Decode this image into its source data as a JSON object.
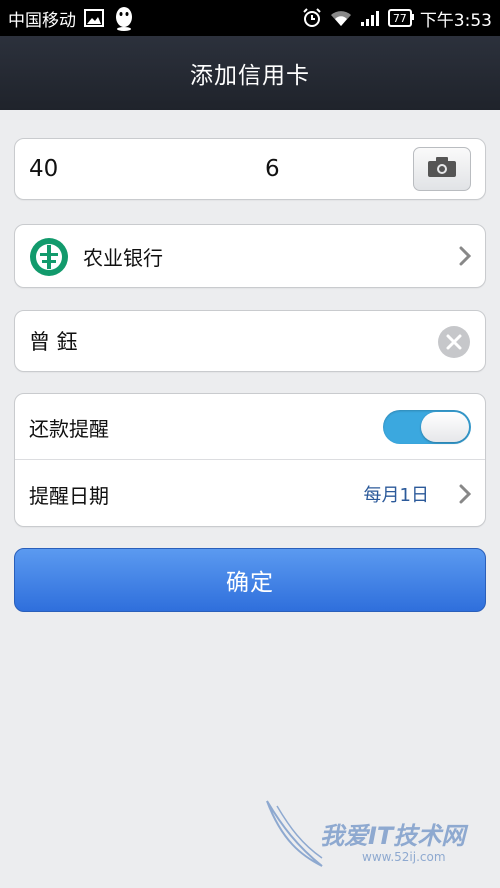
{
  "status_bar": {
    "carrier": "中国移动",
    "battery": "77",
    "time": "下午3:53"
  },
  "header": {
    "title": "添加信用卡"
  },
  "card_number": {
    "value_start": "40",
    "value_end": "6"
  },
  "bank": {
    "name": "农业银行"
  },
  "cardholder": {
    "value": "曾 鈺"
  },
  "settings": {
    "reminder_label": "还款提醒",
    "reminder_on": true,
    "date_label": "提醒日期",
    "date_value": "每月1日"
  },
  "confirm_label": "确定",
  "watermark": {
    "text": "我爱IT技术网",
    "sub": "www.52ij.com"
  },
  "colors": {
    "header_bg": "#262a33",
    "accent_blue": "#3ba8df",
    "button_blue": "#3d7fe6",
    "bank_green": "#129a6c"
  }
}
